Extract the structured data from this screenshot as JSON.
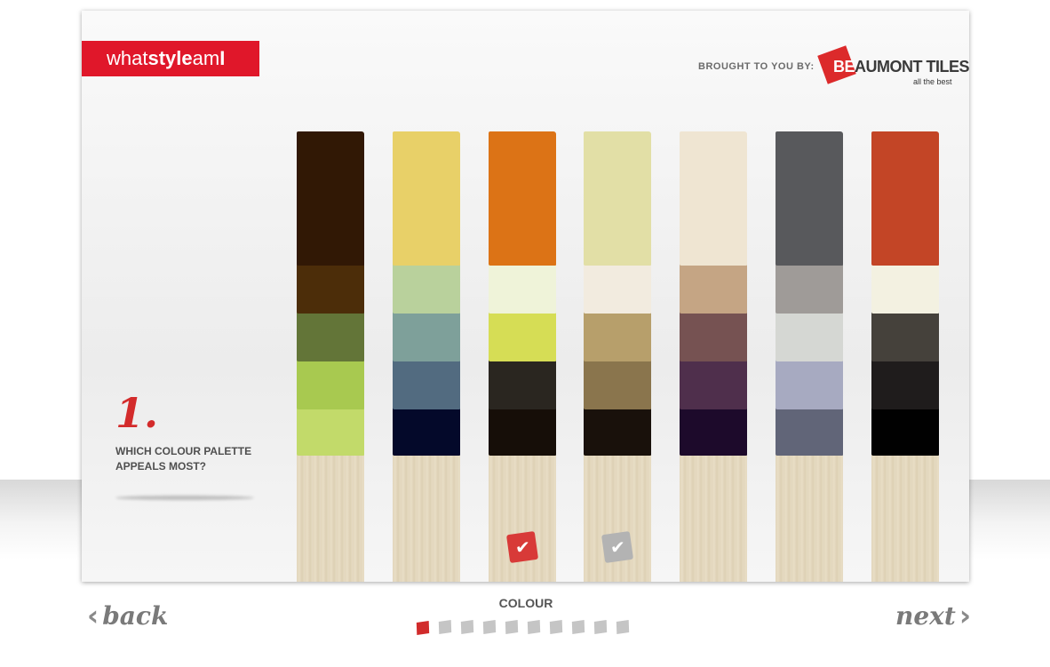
{
  "brand": {
    "app_logo": {
      "part1": "what",
      "part2": "style",
      "part3": "am",
      "part4": "I"
    },
    "sponsor_label": "BROUGHT TO YOU BY:",
    "sponsor_name_first": "BE",
    "sponsor_name_rest": "AUMONT TILES",
    "sponsor_tagline": "all the best"
  },
  "question": {
    "number": "1.",
    "text": "WHICH COLOUR PALETTE APPEALS MOST?"
  },
  "palettes": [
    {
      "id": 1,
      "colors": [
        "#311805",
        "#4c2d09",
        "#637538",
        "#a8c950",
        "#c2da6a"
      ],
      "state": "none"
    },
    {
      "id": 2,
      "colors": [
        "#e8d068",
        "#b9d19c",
        "#7ea09a",
        "#526b80",
        "#04092a"
      ],
      "state": "none"
    },
    {
      "id": 3,
      "colors": [
        "#dc7316",
        "#eff3d9",
        "#d6dd55",
        "#2a2620",
        "#160e08"
      ],
      "state": "selected"
    },
    {
      "id": 4,
      "colors": [
        "#e2dfa6",
        "#f2ebdf",
        "#b79f6b",
        "#8a754d",
        "#19110b"
      ],
      "state": "hover"
    },
    {
      "id": 5,
      "colors": [
        "#efe5d2",
        "#c5a584",
        "#765252",
        "#4f2f4c",
        "#1d0a2b"
      ],
      "state": "none"
    },
    {
      "id": 6,
      "colors": [
        "#58595c",
        "#9f9b98",
        "#d5d7d3",
        "#a7aac1",
        "#616578"
      ],
      "state": "none"
    },
    {
      "id": 7,
      "colors": [
        "#c34526",
        "#f3f1e1",
        "#45413b",
        "#1f1c1c",
        "#010101"
      ],
      "state": "none"
    }
  ],
  "navigation": {
    "back_label": "back",
    "next_label": "next",
    "section_label": "COLOUR",
    "total_steps": 10,
    "current_step": 1
  },
  "colors": {
    "accent": "#e0172a",
    "selected_check": "#d83a38",
    "hover_check": "#b3b3b3",
    "progress_active": "#d12b2b",
    "progress_inactive": "#c5c5c5"
  }
}
